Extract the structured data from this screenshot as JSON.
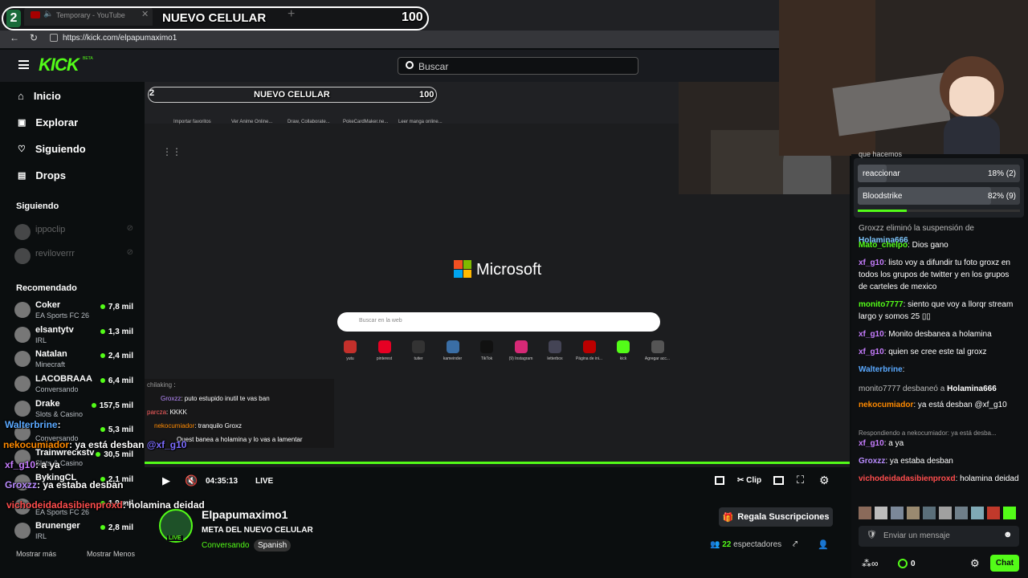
{
  "browser": {
    "tab1_title": "Temporary - YouTube",
    "url": "https://kick.com/elpapumaximo1"
  },
  "goal_overlay": {
    "step": "2",
    "title": "NUEVO CELULAR",
    "count": "100"
  },
  "header": {
    "logo": "KICK",
    "logo_sup": "BETA",
    "search_placeholder": "Buscar"
  },
  "nav": {
    "items": [
      {
        "label": "Inicio",
        "icon": "home-icon"
      },
      {
        "label": "Explorar",
        "icon": "compass-icon"
      },
      {
        "label": "Siguiendo",
        "icon": "heart-icon"
      },
      {
        "label": "Drops",
        "icon": "drops-icon"
      }
    ]
  },
  "following": {
    "title": "Siguiendo",
    "channels": [
      "ippoclip",
      "reviloverrr"
    ]
  },
  "recommended": {
    "title": "Recomendado",
    "channels": [
      {
        "name": "Coker",
        "category": "EA Sports FC 26",
        "viewers": "7,8 mil"
      },
      {
        "name": "elsantytv",
        "category": "IRL",
        "viewers": "1,3 mil"
      },
      {
        "name": "Natalan",
        "category": "Minecraft",
        "viewers": "2,4 mil"
      },
      {
        "name": "LACOBRAAA",
        "category": "Conversando",
        "viewers": "6,4 mil"
      },
      {
        "name": "Drake",
        "category": "Slots & Casino",
        "viewers": "157,5 mil"
      },
      {
        "name": "",
        "category": "Conversando",
        "viewers": "5,3 mil"
      },
      {
        "name": "Trainwreckstv",
        "category": "Slots & Casino",
        "viewers": "30,5 mil"
      },
      {
        "name": "BykingCL",
        "category": "",
        "viewers": "2,1 mil"
      },
      {
        "name": "",
        "category": "EA Sports FC 26",
        "viewers": "1,9 mil"
      },
      {
        "name": "Brunenger",
        "category": "IRL",
        "viewers": "2,8 mil"
      }
    ],
    "show_more": "Mostrar más",
    "show_less": "Mostrar Menos"
  },
  "stream_screen": {
    "step": "2",
    "goal_title": "NUEVO CELULAR",
    "goal_count": "100",
    "bookmarks": [
      "Importar favoritos",
      "Ver Anime Online...",
      "Draw, Collaborate...",
      "PokeCardMaker.ne...",
      "Leer manga online..."
    ],
    "brand": "Microsoft",
    "search_placeholder": "Buscar en la web",
    "shortcuts": [
      "yutu",
      "pinterest",
      "tuiter",
      "kameinder",
      "TikTok",
      "(9) Instagram",
      "letterbox",
      "Página de ini...",
      "kick",
      "Agregar acc..."
    ]
  },
  "stream_chat_overlay": [
    {
      "user": "chilaking",
      "text": ":"
    },
    {
      "user": "Groxzz",
      "text": ": puto estupido inutil te vas ban"
    },
    {
      "user": "parcza",
      "text": ": KKKK"
    },
    {
      "user": "nekocumiador",
      "text": ": tranquilo Groxz"
    },
    {
      "user": "",
      "text": "Quest banea a holamina y lo vas a lamentar"
    }
  ],
  "big_overlay": [
    {
      "user": "Walterbrine",
      "text": ":",
      "color": "#5aa9ff"
    },
    {
      "user": "nekocumiador",
      "text": ": ya está desban",
      "mention": "@xf_g10",
      "color": "#ff8a00"
    },
    {
      "user": "xf_g10",
      "text": ": a ya",
      "color": "#c77dff"
    },
    {
      "user": "Groxzz",
      "text": ": ya estaba desban",
      "color": "#b98cff"
    },
    {
      "user": "vichodeidadasibienproxd",
      "text": ": holamina deidad",
      "color": "#ff4d4d"
    }
  ],
  "controls": {
    "time": "04:35:13",
    "live": "LIVE",
    "clip": "Clip"
  },
  "streamer": {
    "name": "Elpapumaximo1",
    "title": "META DEL NUEVO CELULAR",
    "category": "Conversando",
    "language": "Spanish",
    "live_badge": "LIVE",
    "viewers": "22",
    "viewers_label": "espectadores",
    "gift_button": "Regala Suscripciones"
  },
  "poll": {
    "header": "que hacemos",
    "options": [
      {
        "label": "reaccionar",
        "result": "18% (2)",
        "pct": 18
      },
      {
        "label": "Bloodstrike",
        "result": "82% (9)",
        "pct": 82
      }
    ],
    "progress": 0.3
  },
  "chat": {
    "messages": [
      {
        "user": "Holamina666",
        "text": "",
        "color": "#7ec8ff",
        "pre": "Groxzz eliminó la suspensión de"
      },
      {
        "user": "Mato_chelpo",
        "text": ": Dios gano",
        "color": "#53fc18"
      },
      {
        "user": "xf_g10",
        "text": ": listo voy a difundir tu foto groxz en todos los grupos de twitter y en los grupos de carteles de mexico",
        "color": "#c77dff"
      },
      {
        "user": "monito7777",
        "text": ": siento que voy a llorqr stream largo y somos 25 ▯▯",
        "color": "#53fc18"
      },
      {
        "user": "xf_g10",
        "text": ": Monito desbanea a holamina",
        "color": "#c77dff"
      },
      {
        "user": "xf_g10",
        "text": ": quien se cree este tal groxz",
        "color": "#c77dff"
      },
      {
        "user": "Walterbrine",
        "text": ":",
        "color": "#5aa9ff"
      },
      {
        "user": "Holamina666",
        "text": "",
        "color": "#ffffff",
        "pre": "monito7777 desbaneó a"
      },
      {
        "user": "nekocumiador",
        "text": ": ya está desban @xf_g10",
        "color": "#ff8a00"
      },
      {
        "user": "xf_g10",
        "text": ": a ya",
        "color": "#c77dff",
        "reply": "Respondiendo a nekocumiador: ya está desba..."
      },
      {
        "user": "Groxzz",
        "text": ": ya estaba desban",
        "color": "#b98cff"
      },
      {
        "user": "vichodeidadasibienproxd",
        "text": ": holamina deidad",
        "color": "#ff4d4d"
      }
    ],
    "input_placeholder": "Enviar un mensaje",
    "points": "0",
    "infinity": "∞",
    "chat_button": "Chat"
  }
}
